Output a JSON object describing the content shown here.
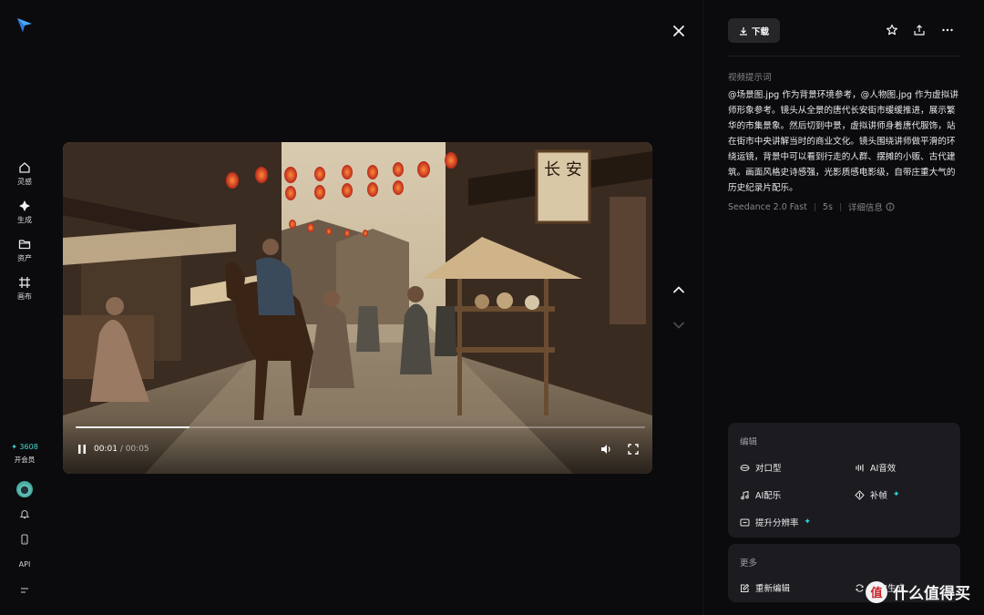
{
  "sidebar": {
    "items": [
      {
        "label": "灵感",
        "icon": "home-icon"
      },
      {
        "label": "生成",
        "icon": "sparkle-icon"
      },
      {
        "label": "资产",
        "icon": "folder-icon"
      },
      {
        "label": "画布",
        "icon": "canvas-grid-icon"
      }
    ],
    "credits": "✦ 3608",
    "vip_label": "开会员",
    "api_label": "API"
  },
  "video": {
    "current_time": "00:01",
    "duration": "/ 00:05",
    "progress": 0.2
  },
  "panel": {
    "download_label": "下载",
    "prompt_title": "视频提示词",
    "prompt_text": "@场景图.jpg 作为背景环境参考，@人物图.jpg 作为虚拟讲师形象参考。镜头从全景的唐代长安街市缓缓推进，展示繁华的市集景象。然后切到中景，虚拟讲师身着唐代服饰，站在街市中央讲解当时的商业文化。镜头围绕讲师做平滑的环绕运镜，背景中可以看到行走的人群、摆摊的小贩、古代建筑。画面风格史诗感强，光影质感电影级，自带庄重大气的历史纪录片配乐。",
    "model": "Seedance 2.0 Fast",
    "length": "5s",
    "details_label": "详细信息"
  },
  "edit_card": {
    "title": "编辑",
    "tools": [
      {
        "label": "对口型",
        "icon": "lips-icon"
      },
      {
        "label": "AI音效",
        "icon": "sound-wave-icon"
      },
      {
        "label": "AI配乐",
        "icon": "music-note-icon"
      },
      {
        "label": "补帧",
        "icon": "frame-icon"
      },
      {
        "label": "提升分辨率",
        "icon": "hd-icon"
      }
    ]
  },
  "more_card": {
    "title": "更多",
    "tools": [
      {
        "label": "重新编辑",
        "icon": "edit-icon"
      },
      {
        "label": "再次生成",
        "icon": "refresh-icon"
      }
    ]
  },
  "watermark": {
    "badge": "值",
    "text": "什么值得买"
  },
  "scene": {
    "sign_text": "长 安"
  },
  "colors": {
    "accent": "#2fd3e0",
    "background": "#0b0b0d",
    "card": "#1c1c20"
  }
}
